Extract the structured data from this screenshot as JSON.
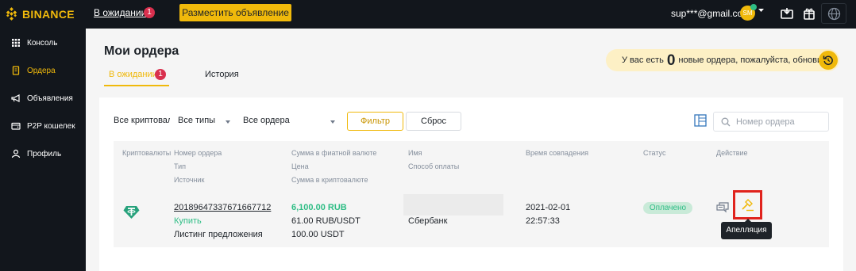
{
  "header": {
    "brand": "BINANCE",
    "pending_link": "В ожидании",
    "pending_count": "1",
    "post_button": "Разместить объявление",
    "email": "sup***@gmail.com",
    "avatar_initials": "SM",
    "accent_color": "#f0b90b"
  },
  "sidebar": {
    "items": [
      {
        "label": "Консоль",
        "icon": "grid-icon"
      },
      {
        "label": "Ордера",
        "icon": "document-icon",
        "active": true
      },
      {
        "label": "Объявления",
        "icon": "megaphone-icon"
      },
      {
        "label": "P2P кошелек",
        "icon": "wallet-icon"
      },
      {
        "label": "Профиль",
        "icon": "user-icon"
      }
    ]
  },
  "page": {
    "title": "Мои ордера",
    "tabs": [
      {
        "label": "В ожидании",
        "count": "1",
        "active": true
      },
      {
        "label": "История"
      }
    ],
    "notice": {
      "prefix": "У вас есть",
      "count": "0",
      "suffix": "новые ордера, пожалуйста, обновите."
    }
  },
  "filters": {
    "crypto": "Все криптовалюты",
    "type": "Все типы",
    "status": "Все ордера",
    "filter_button": "Фильтр",
    "reset_button": "Сброс",
    "search_placeholder": "Номер ордера"
  },
  "table": {
    "headers": {
      "crypto": "Криптовалюты",
      "order_no": "Номер ордера",
      "type": "Тип",
      "source": "Источник",
      "fiat_amount": "Сумма в фиатной валюте",
      "price": "Цена",
      "crypto_amount": "Сумма в криптовалюте",
      "name": "Имя",
      "payment": "Способ оплаты",
      "match_time": "Время совпадения",
      "status": "Статус",
      "action": "Действие"
    },
    "rows": [
      {
        "crypto_icon": "tether-icon",
        "order_no": "20189647337671667712",
        "type": "Купить",
        "source": "Листинг предложения",
        "fiat_amount": "6,100.00 RUB",
        "price": "61.00 RUB/USDT",
        "crypto_amount": "100.00 USDT",
        "payment": "Сбербанк",
        "date": "2021-02-01",
        "time": "22:57:33",
        "status": "Оплачено",
        "appeal_tooltip": "Апелляция"
      }
    ]
  }
}
